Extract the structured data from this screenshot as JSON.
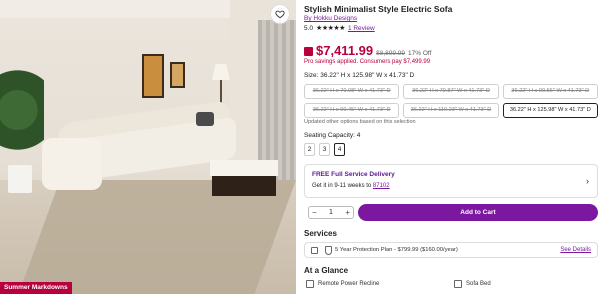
{
  "product": {
    "title": "Stylish Minimalist Style Electric Sofa",
    "brand": "By Hokku Designs",
    "rating": "5.0",
    "stars": "★★★★★",
    "reviews": "1 Review"
  },
  "image": {
    "badge": "Summer Markdowns"
  },
  "pricing": {
    "price": "$7,411.99",
    "old_price": "$8,899.99",
    "discount": "17% Off",
    "promo": "Pro savings applied. Consumers pay $7,499.99"
  },
  "size": {
    "label": "Size: 36.22\" H x 125.98\" W x 41.73\" D",
    "options": [
      "36.22\" H x 70.08\" W x 41.73\" D",
      "36.22\" H x 70.87\" W x 41.73\" D",
      "36.22\" H x 90.55\" W x 41.73\" D",
      "36.22\" H x 90.45\" W x 41.73\" D",
      "36.22\" H x 110.23\" W x 41.73\" D",
      "36.22\" H x 125.98\" W x 41.73\" D"
    ],
    "updated_note": "Updated other options based on this selection"
  },
  "capacity": {
    "label": "Seating Capacity: 4",
    "options": [
      "2",
      "3",
      "4"
    ]
  },
  "delivery": {
    "title": "FREE Full Service Delivery",
    "prefix": "Get it in 9-11 weeks to ",
    "zip": "87102"
  },
  "cart": {
    "quantity": "1",
    "minus": "−",
    "plus": "+",
    "add_label": "Add to Cart"
  },
  "services": {
    "heading": "Services",
    "plan": "5 Year Protection Plan - $799.99 ($160.00/year)",
    "see_details": "See Details"
  },
  "glance": {
    "heading": "At a Glance",
    "features": [
      "Remote Power Recline",
      "Sofa Bed"
    ]
  },
  "icons": {
    "favorite": "heart-icon",
    "chevron": "chevron-right-icon",
    "truck": "truck-icon",
    "shield": "shield-icon"
  },
  "colors": {
    "accent": "#7b189f",
    "sale": "#b8003c"
  }
}
